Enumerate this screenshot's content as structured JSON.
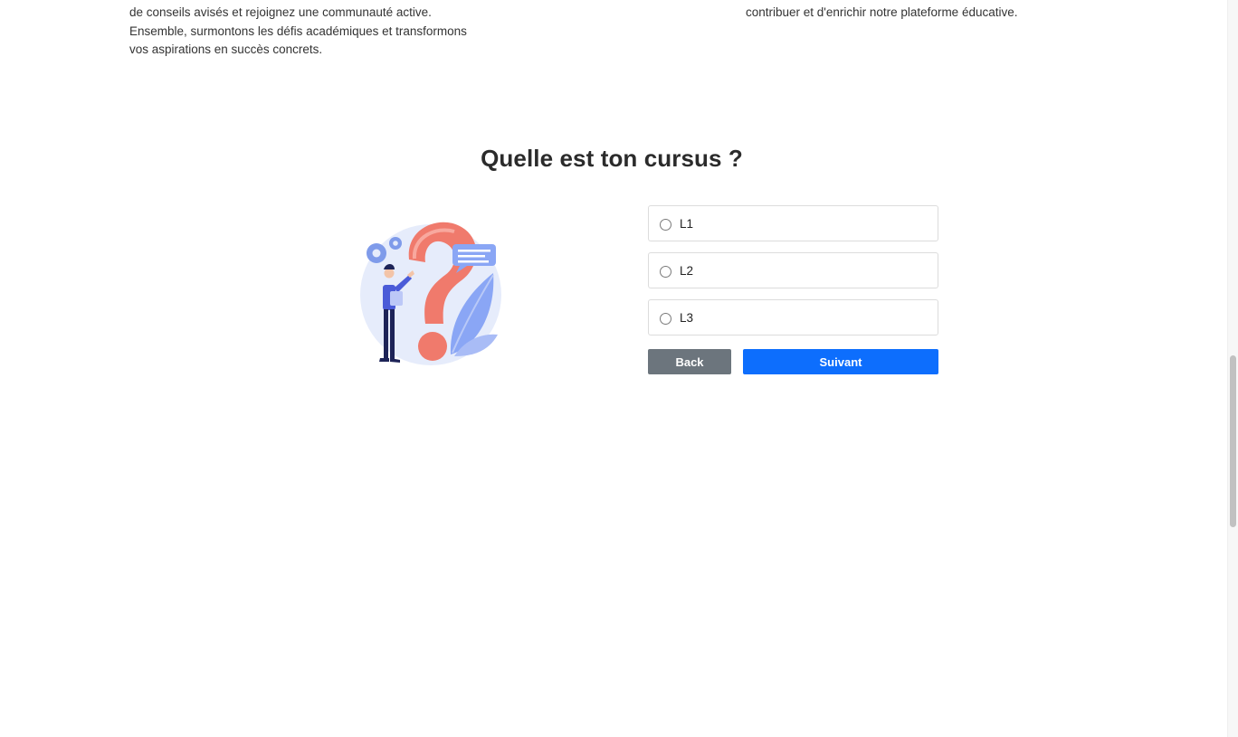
{
  "intro": {
    "left_lines": [
      "de conseils avisés et rejoignez une communauté active.",
      "Ensemble, surmontons les défis académiques et transformons",
      "vos aspirations en succès concrets."
    ],
    "right_line": "contribuer et d'enrichir notre plateforme éducative."
  },
  "question": {
    "title": "Quelle est ton cursus ?",
    "options": [
      {
        "label": "L1"
      },
      {
        "label": "L2"
      },
      {
        "label": "L3"
      }
    ]
  },
  "actions": {
    "back_label": "Back",
    "next_label": "Suivant"
  },
  "colors": {
    "primary": "#0d6efd",
    "secondary": "#6c757d",
    "illustration_accent": "#f07a6c",
    "illustration_blue": "#8aa6f5"
  },
  "icons": {
    "illustration": "question-mark-person-illustration"
  }
}
